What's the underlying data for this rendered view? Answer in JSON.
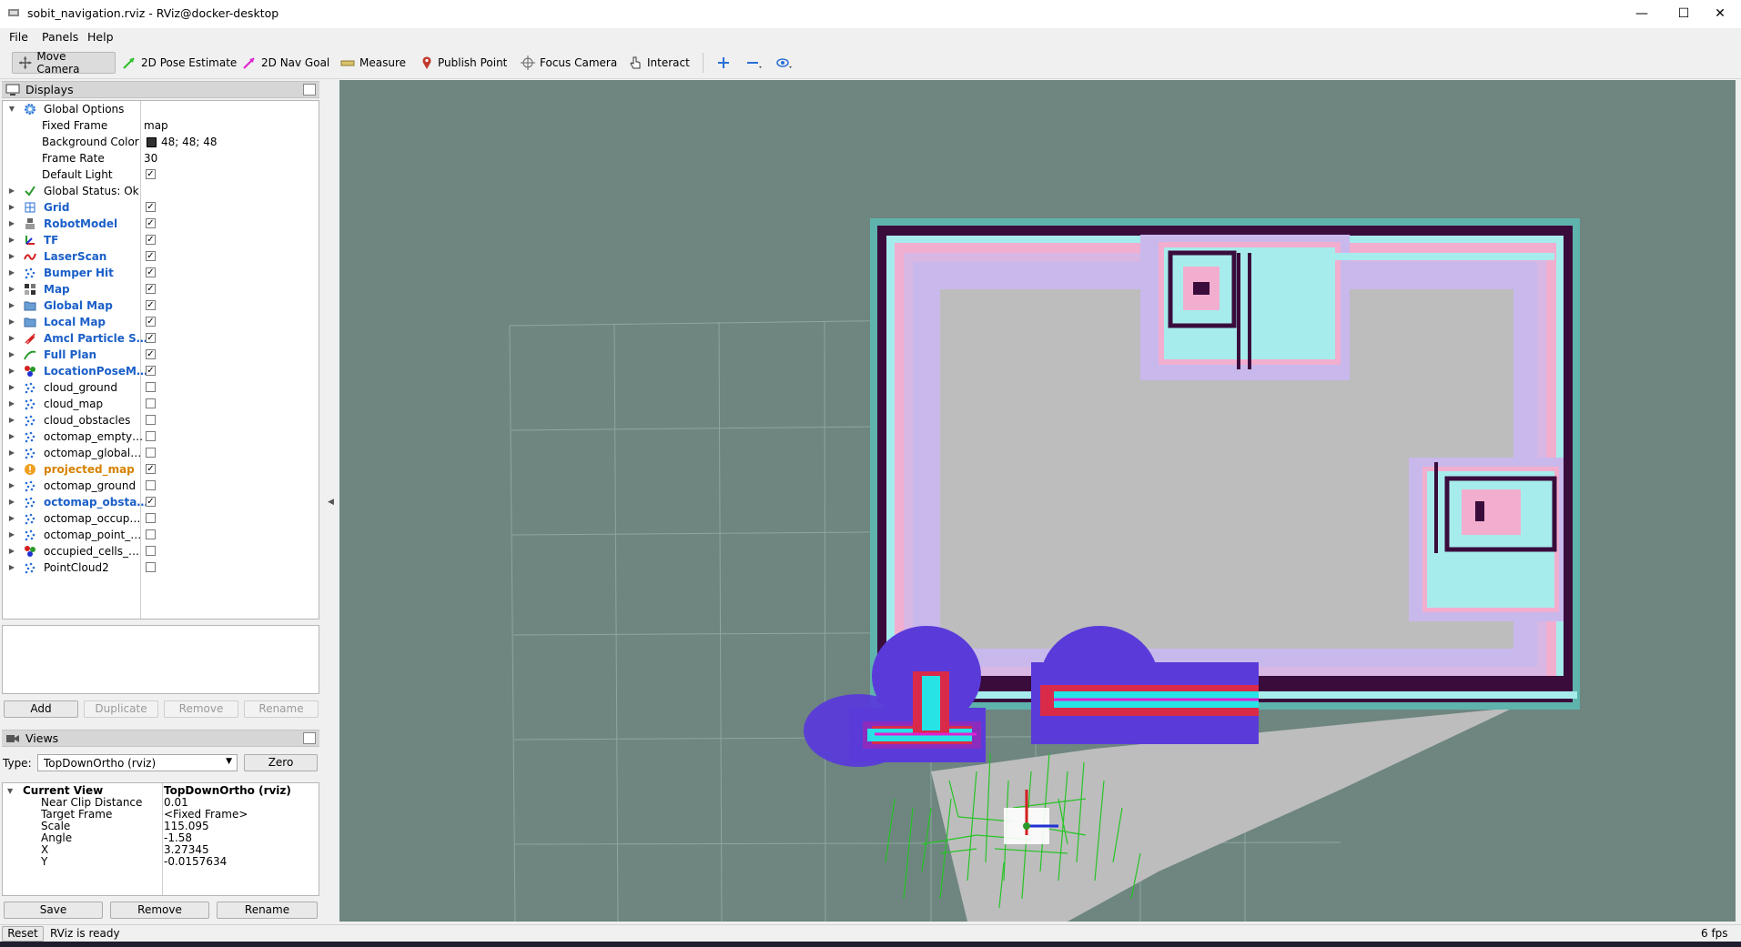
{
  "window": {
    "title": "sobit_navigation.rviz - RViz@docker-desktop",
    "minimize": "—",
    "maximize": "☐",
    "close": "✕"
  },
  "menu": [
    "File",
    "Panels",
    "Help"
  ],
  "toolbar": {
    "move_camera": "Move Camera",
    "pose_estimate": "2D Pose Estimate",
    "nav_goal": "2D Nav Goal",
    "measure": "Measure",
    "publish_point": "Publish Point",
    "focus_camera": "Focus Camera",
    "interact": "Interact"
  },
  "displays": {
    "header": "Displays",
    "global_options": "Global Options",
    "fixed_frame_label": "Fixed Frame",
    "fixed_frame_value": "map",
    "bg_color_label": "Background Color",
    "bg_color_value": "48; 48; 48",
    "frame_rate_label": "Frame Rate",
    "frame_rate_value": "30",
    "default_light_label": "Default Light",
    "global_status": "Global Status: Ok",
    "items": [
      {
        "label": "Grid",
        "checked": true,
        "style": "blue",
        "icon": "grid-icon"
      },
      {
        "label": "RobotModel",
        "checked": true,
        "style": "blue",
        "icon": "robot-icon"
      },
      {
        "label": "TF",
        "checked": true,
        "style": "blue",
        "icon": "tf-axes-icon"
      },
      {
        "label": "LaserScan",
        "checked": true,
        "style": "blue",
        "icon": "laserscan-icon"
      },
      {
        "label": "Bumper Hit",
        "checked": true,
        "style": "blue",
        "icon": "pointcloud-icon"
      },
      {
        "label": "Map",
        "checked": true,
        "style": "blue",
        "icon": "map-icon"
      },
      {
        "label": "Global Map",
        "checked": true,
        "style": "blue",
        "icon": "folder-icon"
      },
      {
        "label": "Local Map",
        "checked": true,
        "style": "blue",
        "icon": "folder-icon"
      },
      {
        "label": "Amcl Particle S…",
        "checked": true,
        "style": "blue",
        "icon": "pose-array-icon"
      },
      {
        "label": "Full Plan",
        "checked": true,
        "style": "blue",
        "icon": "path-icon"
      },
      {
        "label": "LocationPoseM…",
        "checked": true,
        "style": "blue",
        "icon": "marker-icon"
      },
      {
        "label": "cloud_ground",
        "checked": false,
        "style": "normal",
        "icon": "pointcloud-icon"
      },
      {
        "label": "cloud_map",
        "checked": false,
        "style": "normal",
        "icon": "pointcloud-icon"
      },
      {
        "label": "cloud_obstacles",
        "checked": false,
        "style": "normal",
        "icon": "pointcloud-icon"
      },
      {
        "label": "octomap_empty…",
        "checked": false,
        "style": "normal",
        "icon": "pointcloud-icon"
      },
      {
        "label": "octomap_global…",
        "checked": false,
        "style": "normal",
        "icon": "pointcloud-icon"
      },
      {
        "label": "projected_map",
        "checked": true,
        "style": "orange",
        "icon": "warning-icon"
      },
      {
        "label": "octomap_ground",
        "checked": false,
        "style": "normal",
        "icon": "pointcloud-icon"
      },
      {
        "label": "octomap_obsta…",
        "checked": true,
        "style": "blue",
        "icon": "pointcloud-icon"
      },
      {
        "label": "octomap_occup…",
        "checked": false,
        "style": "normal",
        "icon": "pointcloud-icon"
      },
      {
        "label": "octomap_point_…",
        "checked": false,
        "style": "normal",
        "icon": "pointcloud-icon"
      },
      {
        "label": "occupied_cells_…",
        "checked": false,
        "style": "normal",
        "icon": "marker-icon"
      },
      {
        "label": "PointCloud2",
        "checked": false,
        "style": "normal",
        "icon": "pointcloud-icon"
      }
    ],
    "buttons": {
      "add": "Add",
      "duplicate": "Duplicate",
      "remove": "Remove",
      "rename": "Rename"
    }
  },
  "views": {
    "header": "Views",
    "type_label": "Type:",
    "type_value": "TopDownOrtho (rviz)",
    "zero": "Zero",
    "current_view_label": "Current View",
    "current_view_value": "TopDownOrtho (rviz)",
    "props": [
      {
        "k": "Near Clip Distance",
        "v": "0.01"
      },
      {
        "k": "Target Frame",
        "v": "<Fixed Frame>"
      },
      {
        "k": "Scale",
        "v": "115.095"
      },
      {
        "k": "Angle",
        "v": "-1.58"
      },
      {
        "k": "X",
        "v": "3.27345"
      },
      {
        "k": "Y",
        "v": "-0.0157634"
      }
    ],
    "buttons": {
      "save": "Save",
      "remove": "Remove",
      "rename": "Rename"
    }
  },
  "status": {
    "reset": "Reset",
    "message": "RViz is ready",
    "fps": "6 fps"
  },
  "colors": {
    "viewport_bg": "#6e8580",
    "grid_line": "#8ea6a1",
    "free_space": "#bdbdbd",
    "wall": "#3a0c3c",
    "inflation_cyan": "#8fe6e6",
    "inflation_pink": "#f2aecf",
    "costmap_blue": "#5a3bd9",
    "costmap_red": "#d92a4a",
    "laser_cyan": "#27e3e6",
    "particles_green": "#26c426",
    "accent_blue": "#1a5fc8"
  }
}
